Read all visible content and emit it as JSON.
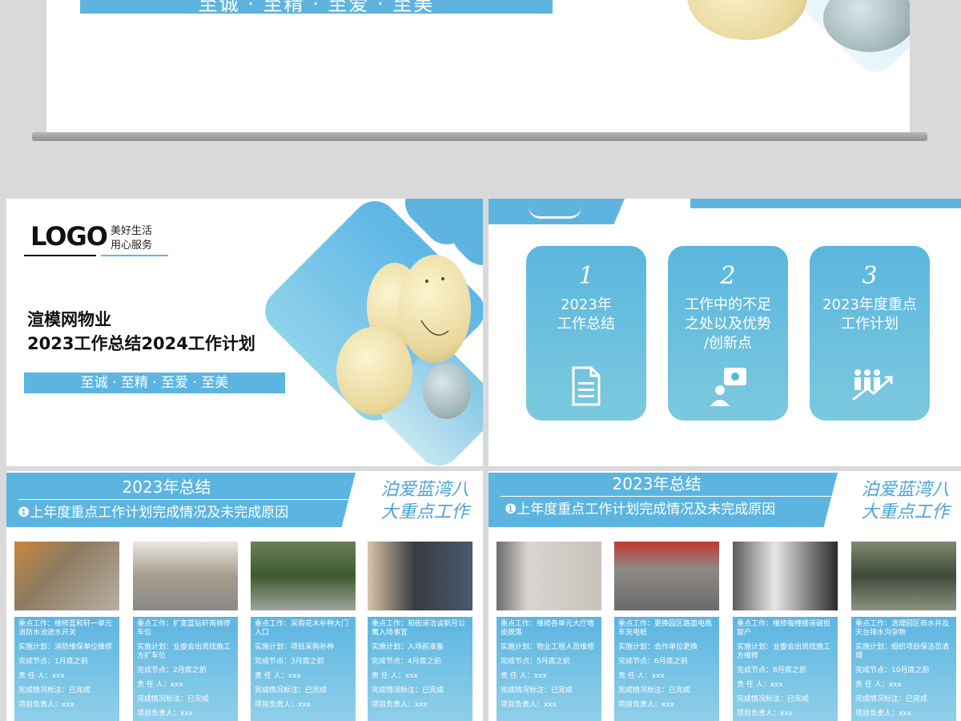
{
  "top_slide": {
    "slogan": "至诚 · 至精 · 至爱 · 至美"
  },
  "cover": {
    "logo": "LOGO",
    "tagline_1": "美好生活",
    "tagline_2": "用心服务",
    "title_1": "渲模网物业",
    "title_2": "2023工作总结2024工作计划",
    "slogan": "至诚 · 至精 · 至爱 · 至美"
  },
  "menu": {
    "items": [
      {
        "num": "1",
        "title_1": "2023年",
        "title_2": "工作总结",
        "title_3": "",
        "icon": "document-icon"
      },
      {
        "num": "2",
        "title_1": "工作中的不足",
        "title_2": "之处以及优势",
        "title_3": "/创新点",
        "icon": "idea-person-icon"
      },
      {
        "num": "3",
        "title_1": "2023年度重点",
        "title_2": "工作计划",
        "title_3": "",
        "icon": "team-growth-icon"
      }
    ]
  },
  "summary_left": {
    "heading": "2023年总结",
    "subheading": "❶上年度重点工作计划完成情况及未完成原因",
    "slogan_1": "泊爱蓝湾八",
    "slogan_2": "大重点工作",
    "cards": [
      {
        "work": "重点工作：维修蓝和轩一单元消防水池进水开关",
        "plan": "实施计划：消防维保单位维修",
        "node": "完成节点：1月底之前",
        "owner": "责  任 人：xxx",
        "status": "完成情况标注：已完成",
        "lead": "项目负责人：xxx"
      },
      {
        "work": "重点工作：扩宽蓝钻轩南侧停车位",
        "plan": "实施计划：业委会出资找施工方扩车位",
        "node": "完成节点：2月底之前",
        "owner": "责  任 人：xxx",
        "status": "完成情况标注：已完成",
        "lead": "项目负责人：xxx"
      },
      {
        "work": "重点工作：采购花木补种大门入口",
        "plan": "实施计划：项目采购补种",
        "node": "完成节点：3月底之前",
        "owner": "责  任 人：xxx",
        "status": "完成情况标注：已完成",
        "lead": "项目负责人：xxx"
      },
      {
        "work": "重点工作：和街道洽谈新月公寓入场事宜",
        "plan": "实施计划：入场前准备",
        "node": "完成节点：4月底之前",
        "owner": "责  任 人：xxx",
        "status": "完成情况标注：已完成",
        "lead": "项目负责人：xxx"
      }
    ]
  },
  "summary_right": {
    "heading": "2023年总结",
    "subheading": "❶上年度重点工作计划完成情况及未完成原因",
    "slogan_1": "泊爱蓝湾八",
    "slogan_2": "大重点工作",
    "cards": [
      {
        "work": "重点工作：维修各单元大厅墙皮脱落",
        "plan": "实施计划：物业工程人员维修",
        "node": "完成节点：5月底之前",
        "owner": "责  任 人：xxx",
        "status": "完成情况标注：已完成",
        "lead": "项目负责人：xxx"
      },
      {
        "work": "重点工作：更换园区路面电瓶车充电桩",
        "plan": "实施计划：合作单位更换",
        "node": "完成节点：6月底之前",
        "owner": "责  任 人：xxx",
        "status": "完成情况标注：已完成",
        "lead": "项目负责人：xxx"
      },
      {
        "work": "重点工作：维修每幢楼道破损窗户",
        "plan": "实施计划：业委会出资找施工方维修",
        "node": "完成节点：8月底之前",
        "owner": "责  任 人：xxx",
        "status": "完成情况标注：已完成",
        "lead": "项目负责人：xxx"
      },
      {
        "work": "重点工作：清理园区雨水井及天台排水沟杂物",
        "plan": "实施计划：组织项目保洁员清理",
        "node": "完成节点：10月底之前",
        "owner": "责  任 人：xxx",
        "status": "完成情况标注：已完成",
        "lead": "项目负责人：xxx"
      }
    ]
  }
}
